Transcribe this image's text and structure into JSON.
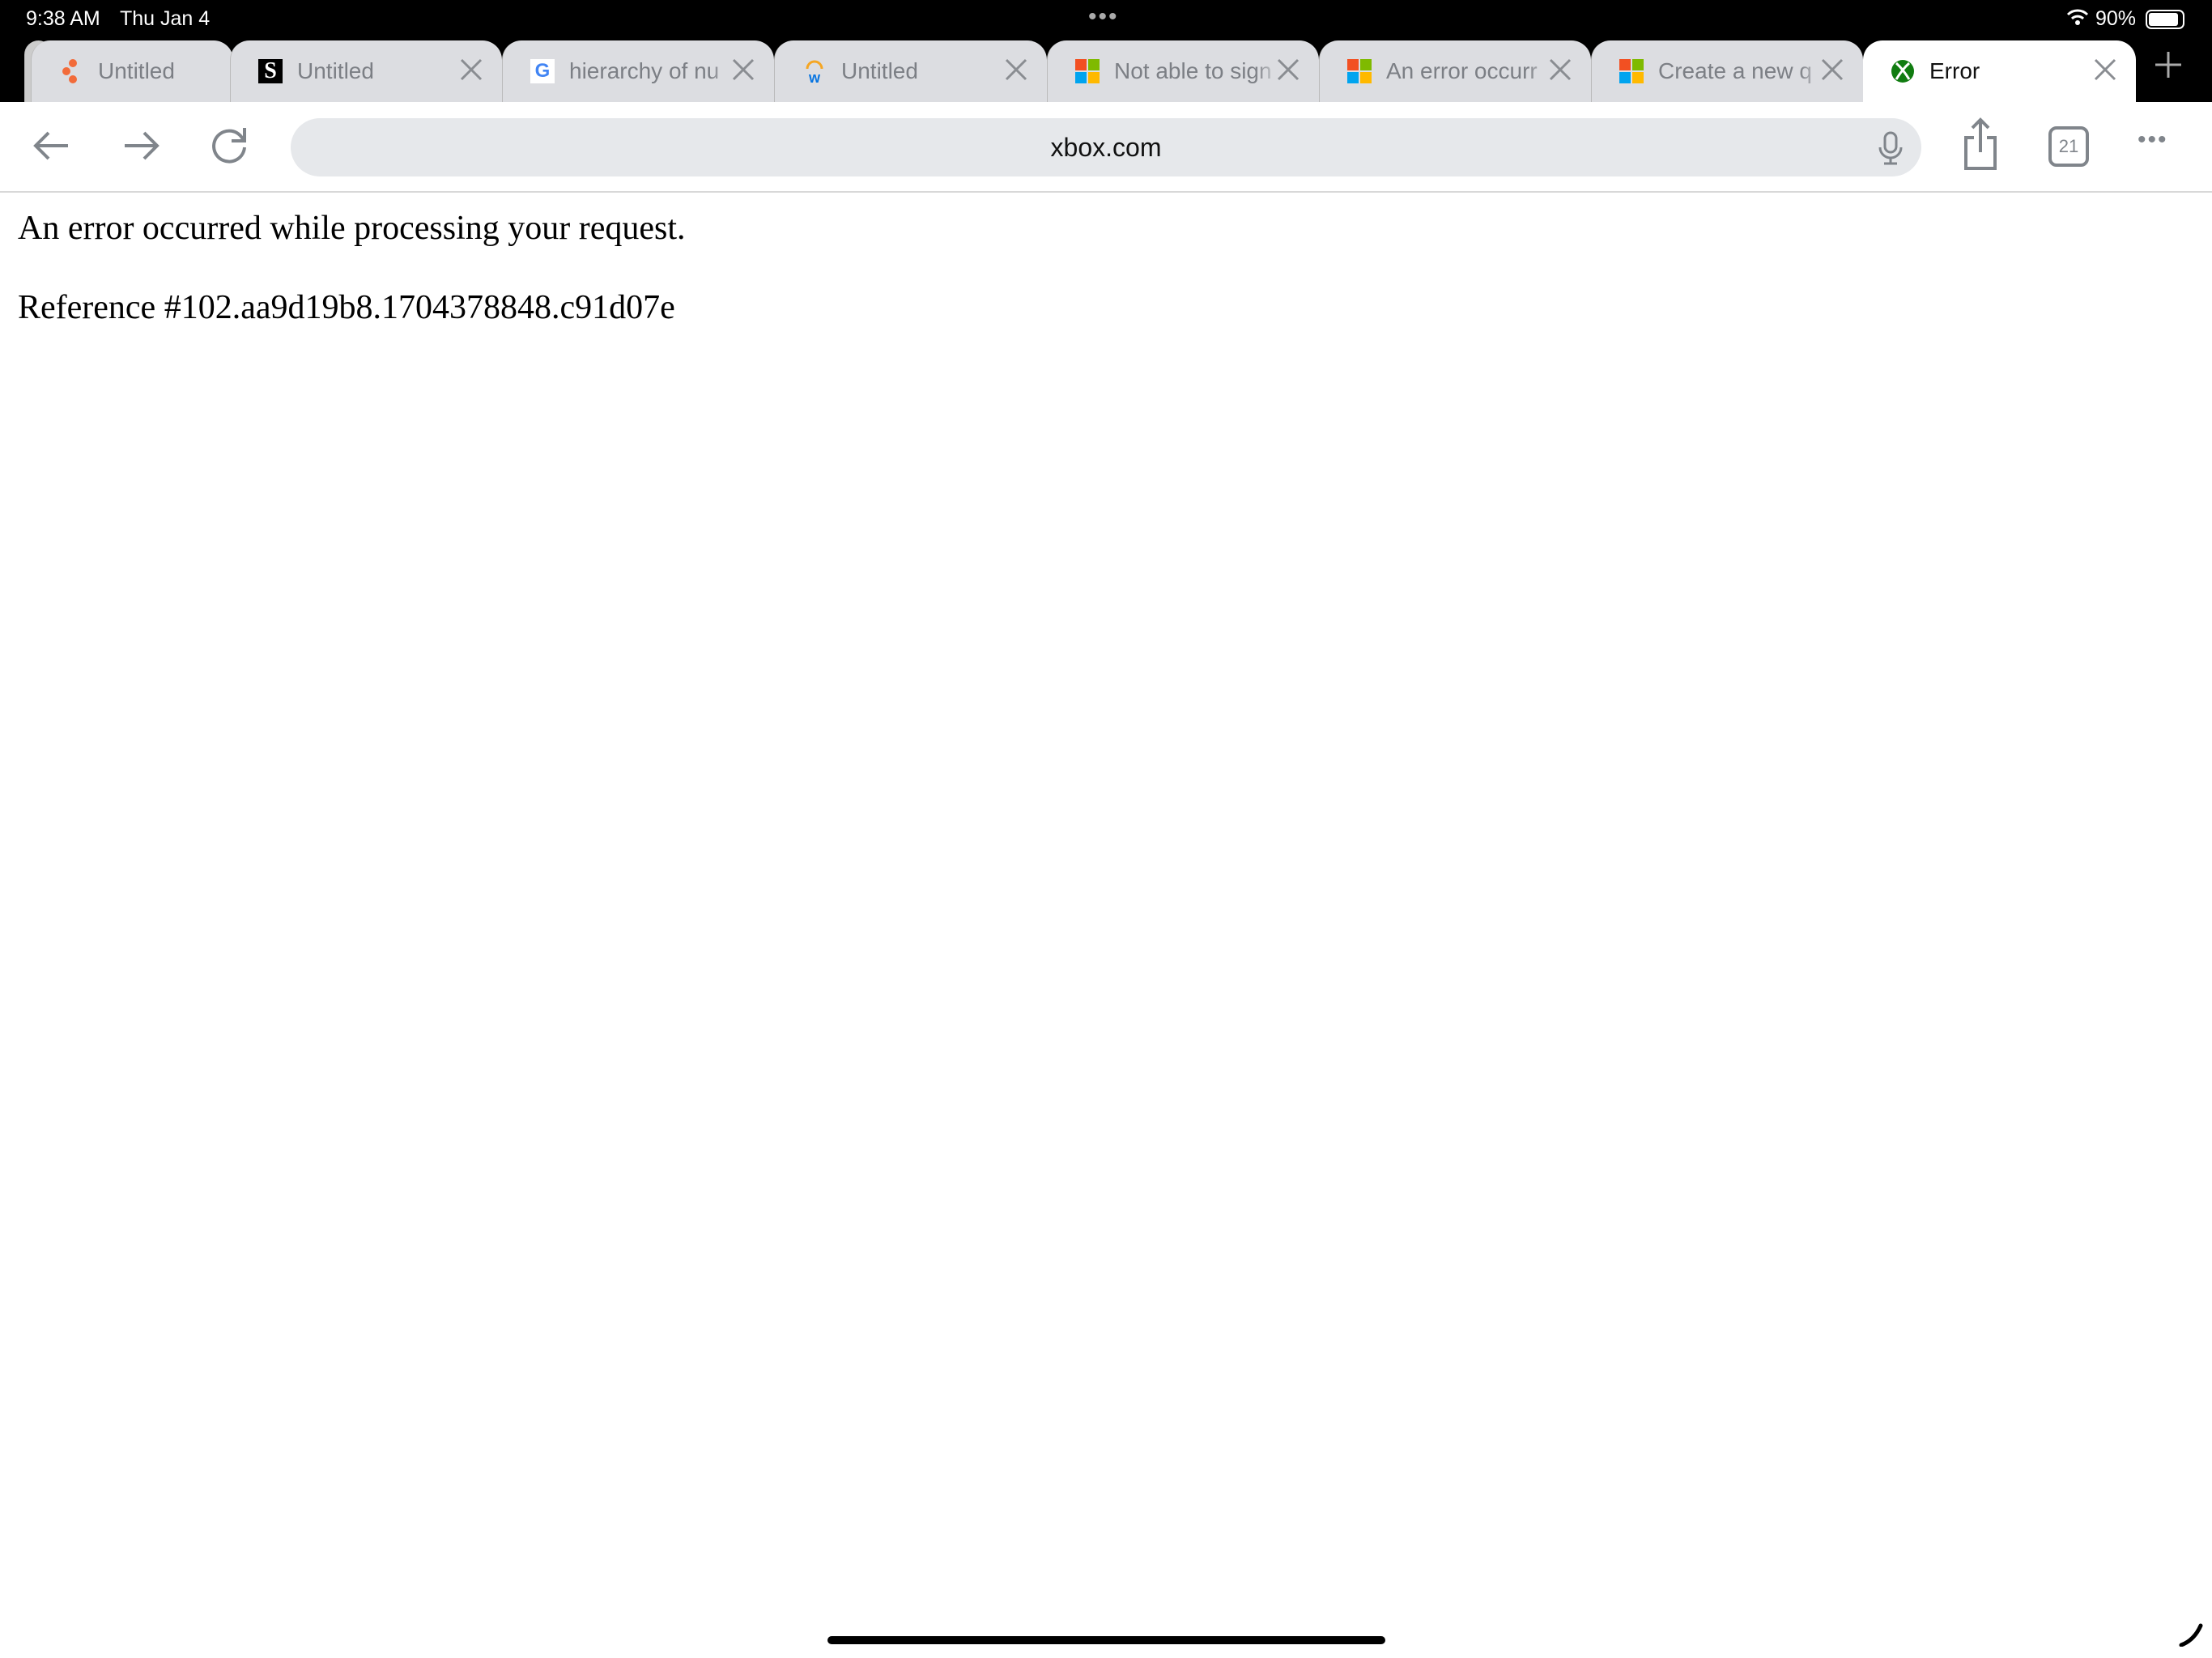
{
  "status_bar": {
    "time": "9:38 AM",
    "date": "Thu Jan 4",
    "battery": "90%",
    "battery_level": 0.9
  },
  "tabs": [
    {
      "title": "Untitled",
      "favicon": "orange-dots-icon",
      "active": false,
      "closable": false
    },
    {
      "title": "Untitled",
      "favicon": "s-logo-icon",
      "active": false,
      "closable": true
    },
    {
      "title": "hierarchy of nu",
      "favicon": "google-icon",
      "active": false,
      "closable": true
    },
    {
      "title": "Untitled",
      "favicon": "workday-icon",
      "active": false,
      "closable": true
    },
    {
      "title": "Not able to sign",
      "favicon": "microsoft-icon",
      "active": false,
      "closable": true
    },
    {
      "title": "An error occurr",
      "favicon": "microsoft-icon",
      "active": false,
      "closable": true
    },
    {
      "title": "Create a new q",
      "favicon": "microsoft-icon",
      "active": false,
      "closable": true
    },
    {
      "title": "Error",
      "favicon": "xbox-icon",
      "active": true,
      "closable": true
    }
  ],
  "toolbar": {
    "url": "xbox.com",
    "tab_count": "21"
  },
  "page": {
    "message": "An error occurred while processing your request.",
    "reference": "Reference #102.aa9d19b8.1704378848.c91d07e"
  },
  "colors": {
    "ms_red": "#f25022",
    "ms_green": "#7fba00",
    "ms_blue": "#00a4ef",
    "ms_yellow": "#ffb900",
    "xbox_green": "#107c10"
  }
}
